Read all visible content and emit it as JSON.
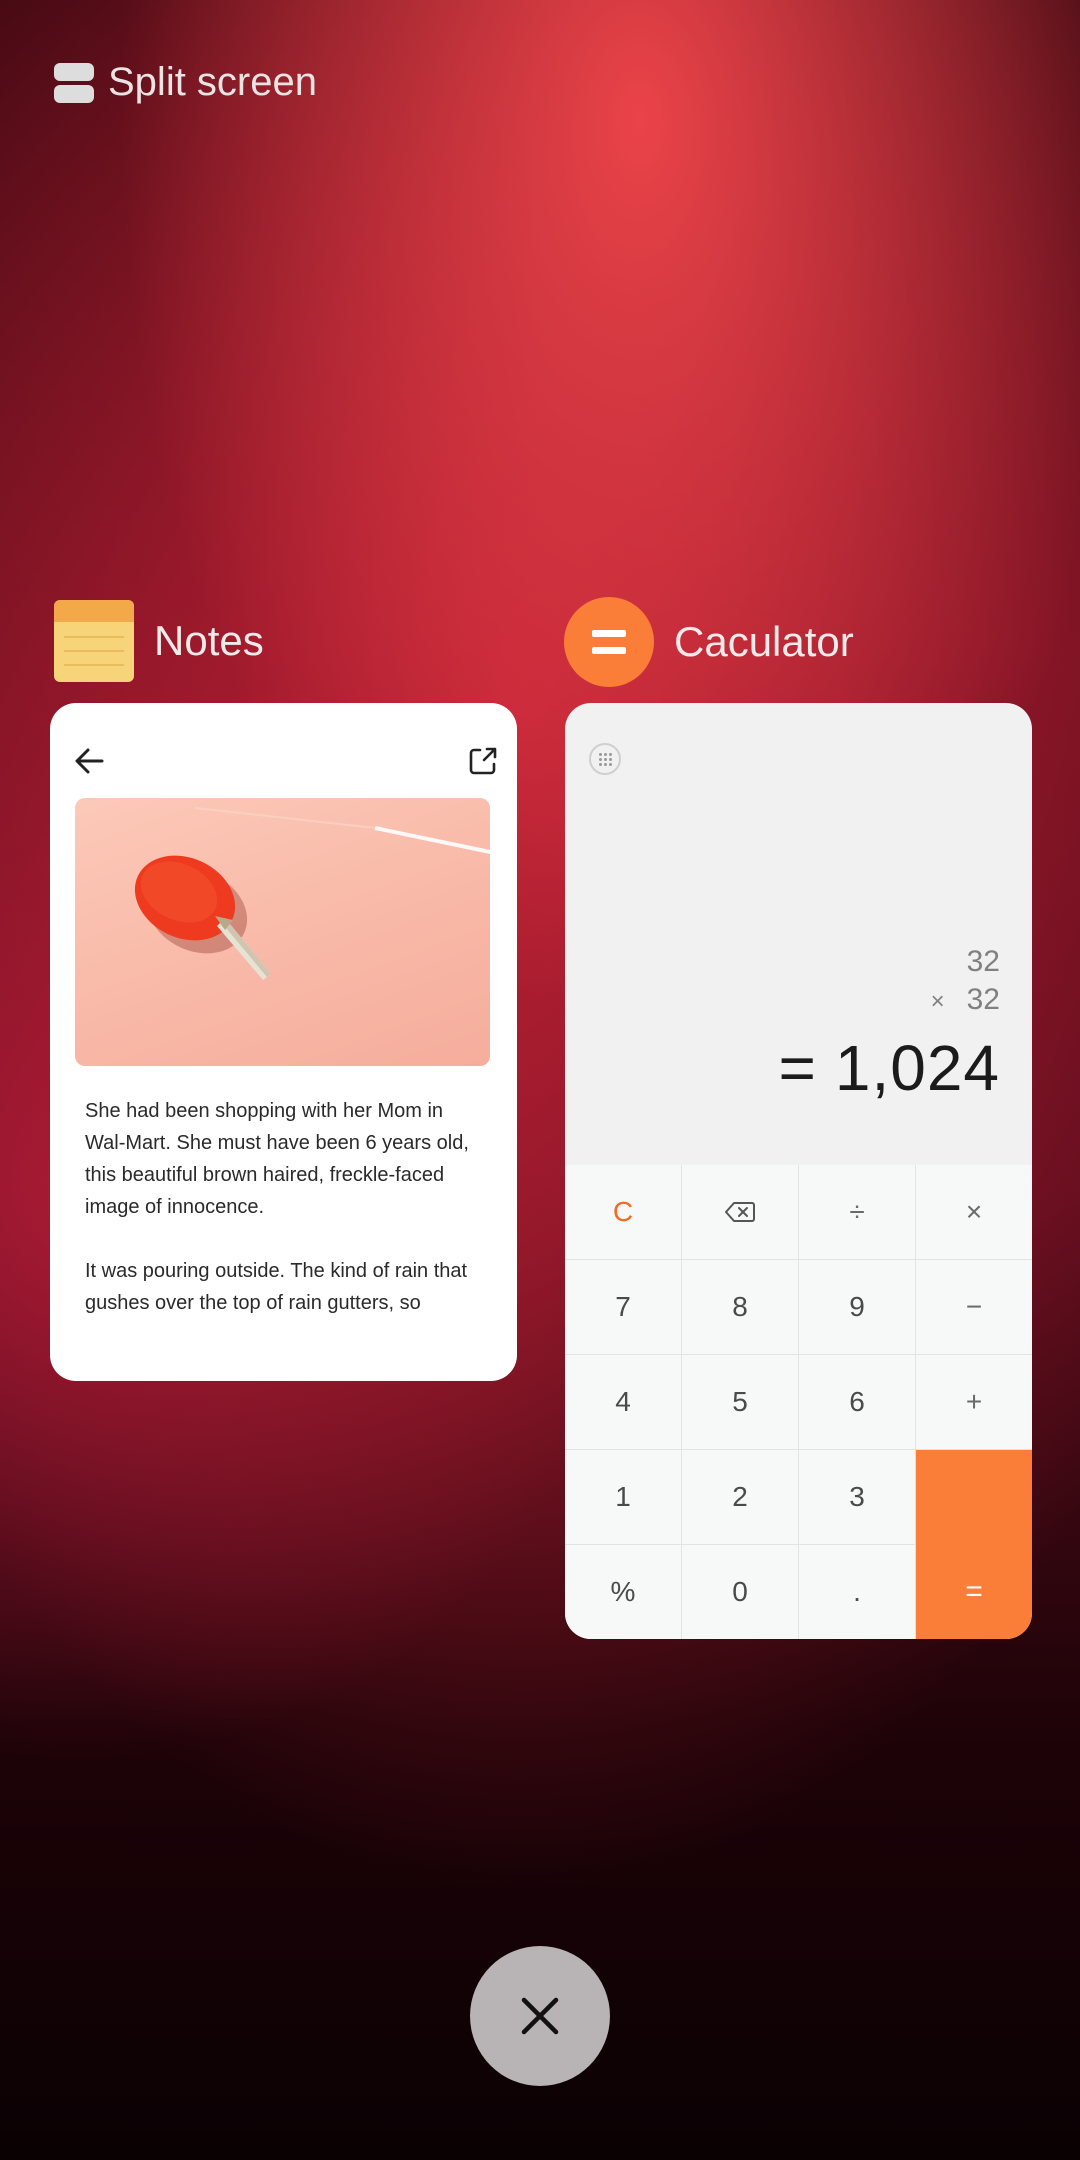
{
  "header": {
    "split_screen_label": "Split screen"
  },
  "apps": [
    {
      "name": "Notes"
    },
    {
      "name": "Caculator"
    }
  ],
  "notes_card": {
    "paragraphs": [
      "She had been shopping with her Mom in Wal-Mart. She must have been 6 years old, this beautiful brown haired, freckle-faced image of innocence.",
      "It was pouring outside. The kind of rain that gushes over the top of rain gutters, so"
    ]
  },
  "calculator": {
    "line1": "32",
    "line2_op": "×",
    "line2": "32",
    "result_eq": "=",
    "result": "1,024",
    "keys": {
      "clear": "C",
      "divide": "÷",
      "multiply": "×",
      "minus": "−",
      "plus": "+",
      "k7": "7",
      "k8": "8",
      "k9": "9",
      "k4": "4",
      "k5": "5",
      "k6": "6",
      "k1": "1",
      "k2": "2",
      "k3": "3",
      "percent": "%",
      "k0": "0",
      "dot": ".",
      "equals": "="
    }
  },
  "colors": {
    "accent": "#fa7d38",
    "card_bg": "#ffffff",
    "calc_bg": "#f0f1f0"
  },
  "icons": [
    "split-screen-icon",
    "notes-app-icon",
    "calculator-app-icon",
    "back-arrow-icon",
    "share-icon",
    "menu-grid-icon",
    "backspace-icon",
    "close-icon"
  ]
}
